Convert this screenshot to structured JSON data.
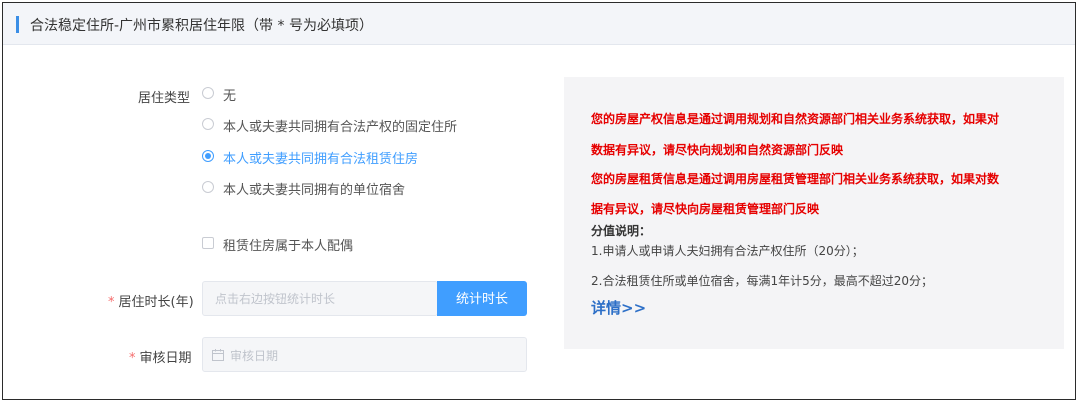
{
  "header": {
    "title": "合法稳定住所-广州市累积居住年限（带 * 号为必填项）"
  },
  "form": {
    "residence_type_label": "居住类型",
    "residence_options": [
      {
        "label": "无",
        "selected": false
      },
      {
        "label": "本人或夫妻共同拥有合法产权的固定住所",
        "selected": false
      },
      {
        "label": "本人或夫妻共同拥有合法租赁住房",
        "selected": true
      },
      {
        "label": "本人或夫妻共同拥有的单位宿舍",
        "selected": false
      }
    ],
    "spouse_checkbox_label": "租赁住房属于本人配偶",
    "required_mark": "*",
    "duration_label": "居住时长(年)",
    "duration_placeholder": "点击右边按钮统计时长",
    "calc_button": "统计时长",
    "review_date_label": "审核日期",
    "review_date_placeholder": "审核日期"
  },
  "panel": {
    "red_lines": [
      "您的房屋产权信息是通过调用规划和自然资源部门相关业务系统获取，如果对",
      "数据有异议，请尽快向规划和自然资源部门反映",
      "您的房屋租赁信息是通过调用房屋租赁管理部门相关业务系统获取，如果对数",
      "据有异议，请尽快向房屋租赁管理部门反映"
    ],
    "score_title": "分值说明：",
    "score_notes": [
      "1.申请人或申请人夫妇拥有合法产权住所（20分）；",
      "2.合法租赁住所或单位宿舍，每满1年计5分，最高不超过20分；"
    ],
    "details_link": "详情>>"
  },
  "colors": {
    "accent": "#409eff",
    "warning": "#e60000",
    "link": "#2d6fc7"
  }
}
